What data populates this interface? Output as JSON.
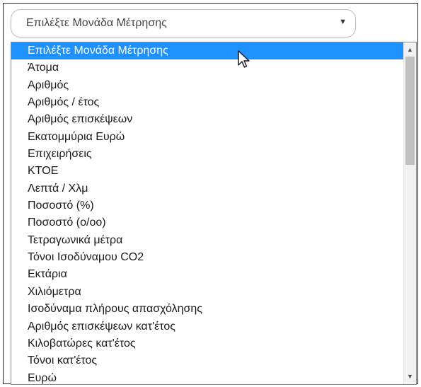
{
  "select": {
    "value": "Επιλέξτε Μονάδα Μέτρησης",
    "arrow_icon": "dropdown-triangle-icon"
  },
  "listbox": {
    "options": [
      "Επιλέξτε Μονάδα Μέτρησης",
      "Άτομα",
      "Αριθμός",
      "Αριθμός / έτος",
      "Αριθμός επισκέψεων",
      "Εκατομμύρια Ευρώ",
      "Επιχειρήσεις",
      "ΚΤΟΕ",
      "Λεπτά / Χλμ",
      "Ποσοστό (%)",
      "Ποσοστό (ο/οο)",
      "Τετραγωνικά μέτρα",
      "Τόνοι Ισοδύναμου CO2",
      "Εκτάρια",
      "Χιλιόμετρα",
      "Ισοδύναμα πλήρους απασχόλησης",
      "Αριθμός επισκέψεων κατ'έτος",
      "Κιλοβατώρες κατ'έτος",
      "Τόνοι κατ'έτος",
      "Ευρώ"
    ],
    "selected_index": 0
  },
  "colors": {
    "selected_bg": "#1e90ff",
    "selected_text": "#ffffff"
  }
}
